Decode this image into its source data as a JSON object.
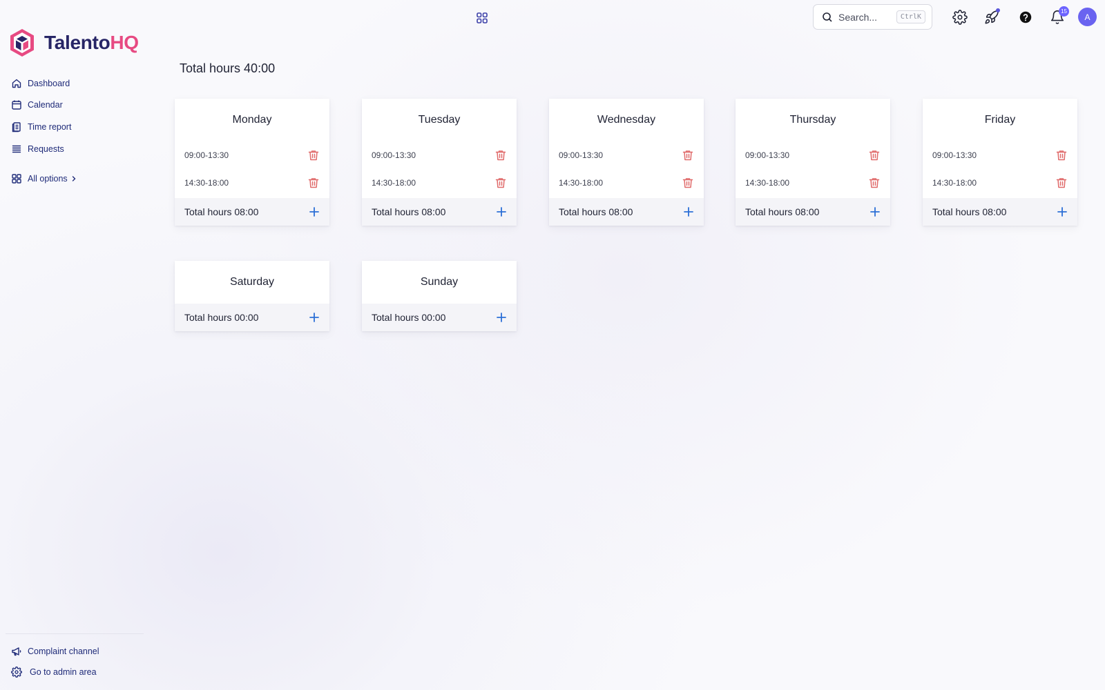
{
  "app": {
    "name_part1": "Talento",
    "name_part2": "HQ"
  },
  "topbar": {
    "search_placeholder": "Search...",
    "search_shortcut": "CtrlK",
    "notification_count": "15",
    "avatar_initial": "A"
  },
  "sidebar": {
    "items": [
      {
        "label": "Dashboard",
        "icon": "home-icon"
      },
      {
        "label": "Calendar",
        "icon": "calendar-icon"
      },
      {
        "label": "Time report",
        "icon": "report-icon"
      },
      {
        "label": "Requests",
        "icon": "list-icon"
      }
    ],
    "all_options": "All options",
    "bottom": [
      {
        "label": "Complaint channel",
        "icon": "megaphone-icon"
      },
      {
        "label": "Go to admin area",
        "icon": "gear-icon"
      }
    ]
  },
  "main": {
    "title": "Total hours 40:00",
    "days": [
      {
        "name": "Monday",
        "slots": [
          "09:00-13:30",
          "14:30-18:00"
        ],
        "total": "Total hours 08:00"
      },
      {
        "name": "Tuesday",
        "slots": [
          "09:00-13:30",
          "14:30-18:00"
        ],
        "total": "Total hours 08:00"
      },
      {
        "name": "Wednesday",
        "slots": [
          "09:00-13:30",
          "14:30-18:00"
        ],
        "total": "Total hours 08:00"
      },
      {
        "name": "Thursday",
        "slots": [
          "09:00-13:30",
          "14:30-18:00"
        ],
        "total": "Total hours 08:00"
      },
      {
        "name": "Friday",
        "slots": [
          "09:00-13:30",
          "14:30-18:00"
        ],
        "total": "Total hours 08:00"
      },
      {
        "name": "Saturday",
        "slots": [],
        "total": "Total hours 00:00"
      },
      {
        "name": "Sunday",
        "slots": [],
        "total": "Total hours 00:00"
      }
    ]
  },
  "colors": {
    "accent": "#1e2a78",
    "danger": "#e06a6a",
    "plus": "#2b6fd6",
    "brand_pink": "#e74a82",
    "brand_navy": "#272566"
  }
}
